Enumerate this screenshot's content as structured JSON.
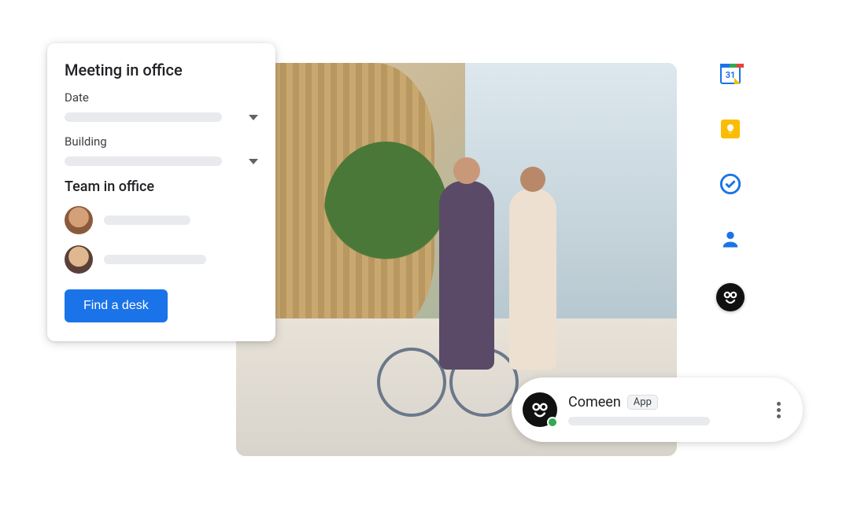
{
  "card": {
    "title": "Meeting in office",
    "date_label": "Date",
    "building_label": "Building",
    "team_title": "Team in office",
    "cta_label": "Find a desk"
  },
  "chip": {
    "name": "Comeen",
    "badge": "App"
  },
  "sidebar": {
    "calendar_day": "31"
  },
  "icons": {
    "calendar": "calendar-icon",
    "keep": "keep-icon",
    "tasks": "tasks-icon",
    "contacts": "contacts-icon",
    "comeen": "comeen-icon"
  }
}
